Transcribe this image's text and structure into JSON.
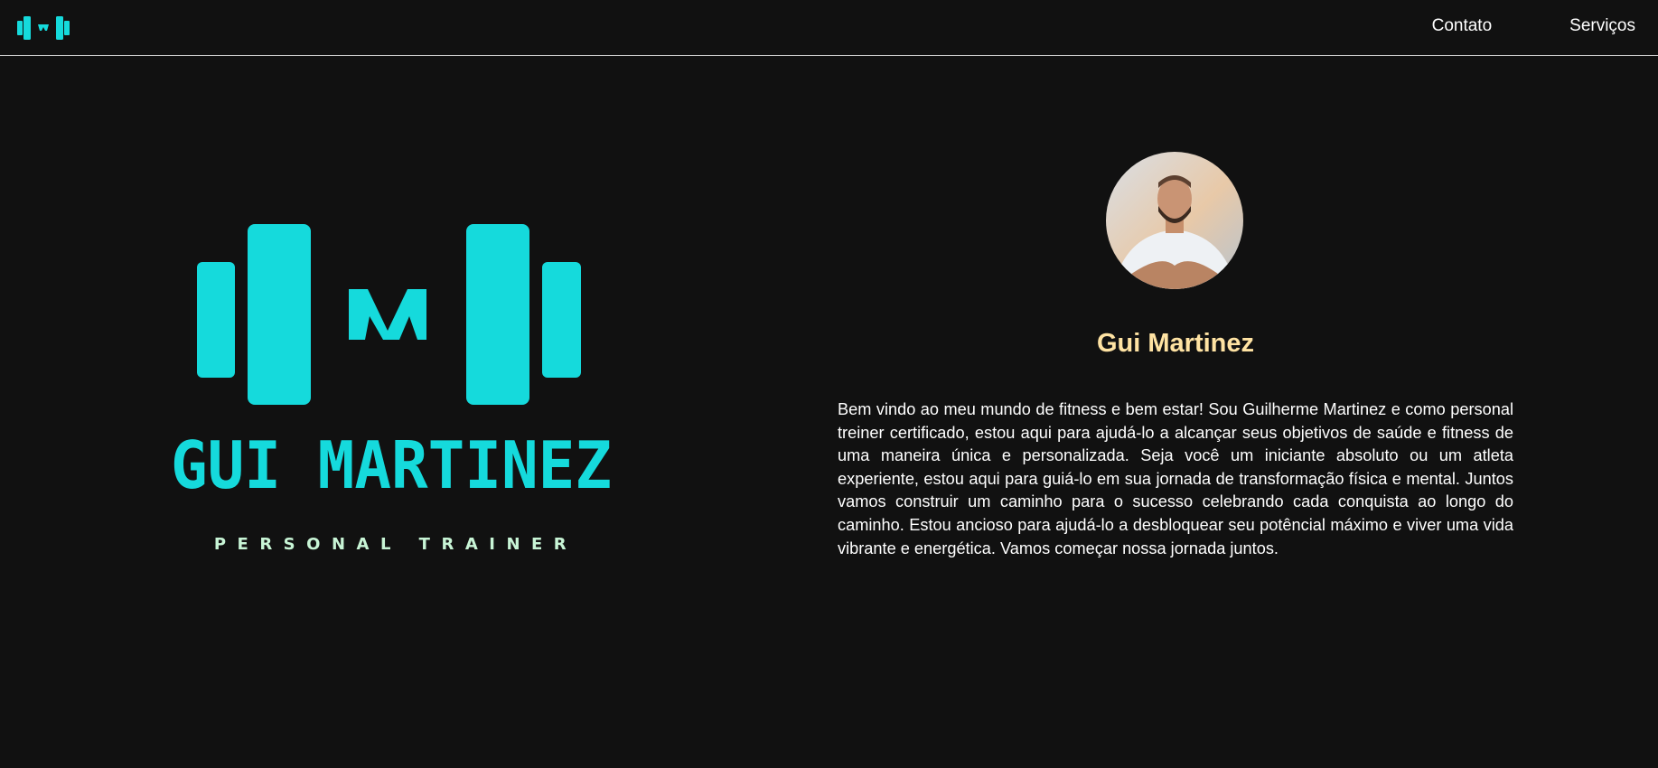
{
  "nav": {
    "logo_icon": "dumbbell-m-logo-icon",
    "links": [
      {
        "label": "Contato"
      },
      {
        "label": "Serviços"
      }
    ]
  },
  "hero": {
    "wordmark": "GUI MARTINEZ",
    "tagline": "PERSONAL TRAINER",
    "logo_color": "#15dadc",
    "tagline_color": "#c8f5d6"
  },
  "profile": {
    "avatar_icon": "avatar-photo",
    "name": "Gui Martinez",
    "name_color": "#ffe3a3",
    "bio": "Bem vindo ao meu mundo de fitness e bem estar! Sou Guilherme Martinez e como personal treiner certificado, estou aqui para ajudá-lo a alcançar seus objetivos de saúde e fitness de uma maneira única e personalizada. Seja você um iniciante absoluto ou um atleta experiente, estou aqui para guiá-lo em sua jornada de transformação física e mental. Juntos vamos construir um caminho para o sucesso celebrando cada conquista ao longo do caminho. Estou ancioso para ajudá-lo a desbloquear seu potêncial máximo e viver uma vida vibrante e energética. Vamos começar nossa jornada juntos."
  }
}
